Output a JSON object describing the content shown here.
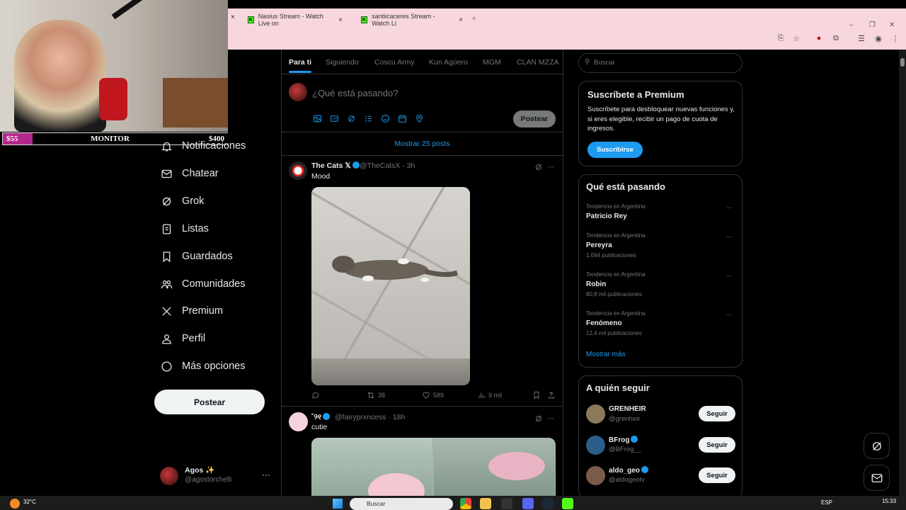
{
  "overlay": {
    "monitor_left": "$55",
    "monitor_title": "MONITOR",
    "monitor_right": "$400"
  },
  "browser": {
    "tabs": [
      {
        "label": "Nasius Stream - Watch Live on"
      },
      {
        "label": "santiicaceres Stream - Watch Li"
      }
    ],
    "close_glyph": "×",
    "new_tab_glyph": "+",
    "window_controls": [
      "–",
      "❐",
      "✕"
    ]
  },
  "nav": {
    "items": [
      {
        "label": "Notificaciones",
        "icon": "bell-icon"
      },
      {
        "label": "Chatear",
        "icon": "envelope-icon"
      },
      {
        "label": "Grok",
        "icon": "grok-icon"
      },
      {
        "label": "Listas",
        "icon": "list-icon"
      },
      {
        "label": "Guardados",
        "icon": "bookmark-icon"
      },
      {
        "label": "Comunidades",
        "icon": "people-icon"
      },
      {
        "label": "Premium",
        "icon": "x-logo-icon"
      },
      {
        "label": "Perfil",
        "icon": "person-icon"
      },
      {
        "label": "Más opciones",
        "icon": "more-circle-icon"
      }
    ],
    "post_button": "Postear",
    "account": {
      "name": "Agos ✨",
      "handle": "@agostorchelli",
      "more": "···"
    }
  },
  "timeline": {
    "tabs": [
      "Para ti",
      "Siguiendo",
      "Coscu Army",
      "Kun Agüero",
      "MGM",
      "CLAN MZZA"
    ],
    "compose_placeholder": "¿Qué está pasando?",
    "compose_post_button": "Postear",
    "show_posts": "Mostrar 25 posts",
    "tweets": [
      {
        "name": "The Cats 𝕏",
        "handle": "@TheCatsX · 3h",
        "text": "Mood",
        "replies": "",
        "retweets": "38",
        "likes": "589",
        "views": "9 mil"
      },
      {
        "name": "˚୨୧",
        "handle": "@fairyprxncess · 18h",
        "text": "cutie"
      }
    ],
    "more": "···"
  },
  "sidebar_right": {
    "search_placeholder": "Buscar",
    "premium": {
      "title": "Suscríbete a Premium",
      "description": "Suscríbete para desbloquear nuevas funciones y, si eres elegible, recibir un pago de cuota de ingresos.",
      "button": "Suscribirse"
    },
    "trends": {
      "title": "Qué está pasando",
      "items": [
        {
          "context": "Tendencia en Argentina",
          "name": "Patricio Rey",
          "count": ""
        },
        {
          "context": "Tendencia en Argentina",
          "name": "Pereyra",
          "count": "1.694 publicaciones"
        },
        {
          "context": "Tendencia en Argentina",
          "name": "Robin",
          "count": "80,8 mil publicaciones"
        },
        {
          "context": "Tendencia en Argentina",
          "name": "Fenómeno",
          "count": "12,4 mil publicaciones"
        }
      ],
      "more": "Mostrar más"
    },
    "who_to_follow": {
      "title": "A quién seguir",
      "items": [
        {
          "name": "GRENHEIR",
          "handle": "@grenheir",
          "button": "Seguir",
          "avatar_color": "#8a7a5a"
        },
        {
          "name": "BFrog",
          "handle": "@BFrog__",
          "button": "Seguir",
          "avatar_color": "#2c5e8a"
        },
        {
          "name": "aldo_geo",
          "handle": "@aldogeotv",
          "button": "Seguir",
          "avatar_color": "#7a5a4a"
        }
      ]
    }
  },
  "taskbar": {
    "weather": "32°C",
    "search": "Buscar",
    "language": "ESP",
    "time": "15:33"
  },
  "colors": {
    "accent": "#1d9bf0",
    "background": "#000000",
    "tab_strip": "#f7d7dd",
    "kick_green": "#53fc18",
    "monitor_pink": "#b4288c"
  }
}
